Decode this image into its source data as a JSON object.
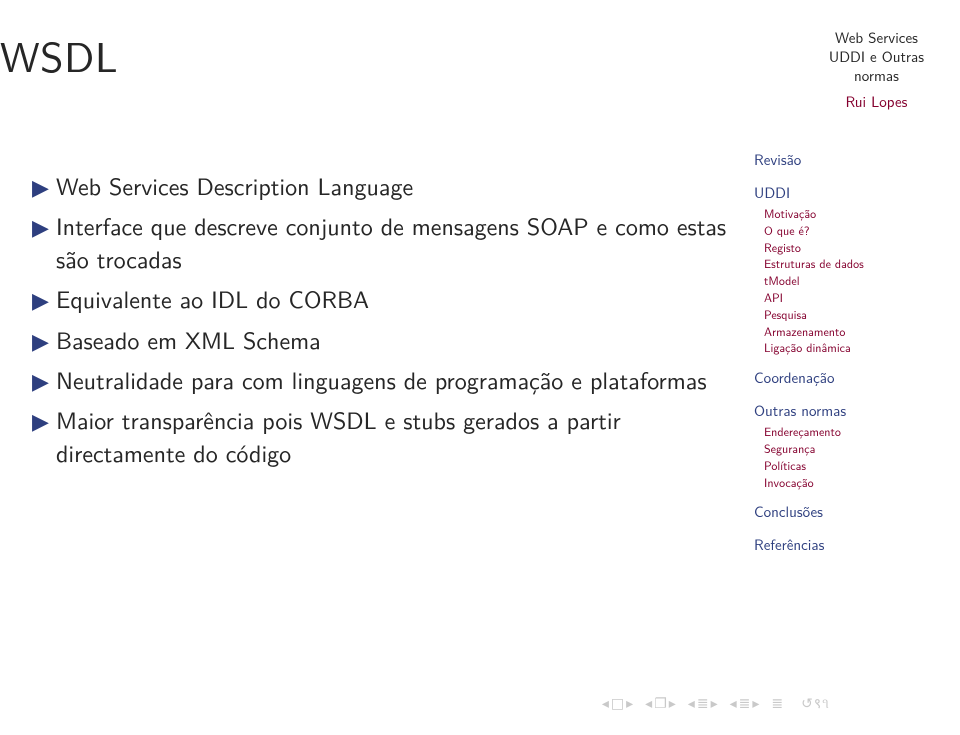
{
  "title": "WSDL",
  "header": {
    "line1": "Web Services",
    "line2": "UDDI e Outras",
    "line3": "normas",
    "author": "Rui Lopes"
  },
  "bullets": [
    "Web Services Description Language",
    "Interface que descreve conjunto de mensagens SOAP e como estas são trocadas",
    "Equivalente ao IDL do CORBA",
    "Baseado em XML Schema",
    "Neutralidade para com linguagens de programação e plataformas",
    "Maior transparência pois WSDL e stubs gerados a partir directamente do código"
  ],
  "sidebar": {
    "sections": [
      {
        "title": "Revisão",
        "items": []
      },
      {
        "title": "UDDI",
        "items": [
          "Motivação",
          "O que é?",
          "Registo",
          "Estruturas de dados",
          "tModel",
          "API",
          "Pesquisa",
          "Armazenamento",
          "Ligação dinâmica"
        ]
      },
      {
        "title": "Coordenação",
        "items": []
      },
      {
        "title": "Outras normas",
        "items": [
          "Endereçamento",
          "Segurança",
          "Políticas",
          "Invocação"
        ]
      },
      {
        "title": "Conclusões",
        "items": []
      },
      {
        "title": "Referências",
        "items": []
      }
    ]
  },
  "nav": {
    "slide_back": "◂",
    "doc_icon": "❐",
    "line_left": "≡",
    "line_right": "≡",
    "summary": "≡",
    "refresh": "↺⟲"
  }
}
